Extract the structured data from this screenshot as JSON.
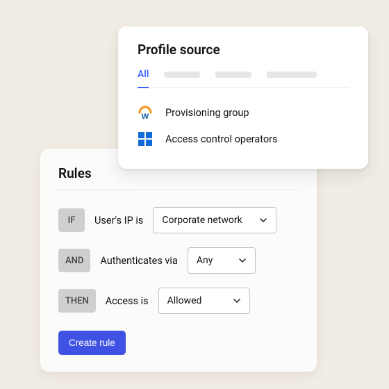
{
  "profile": {
    "title": "Profile source",
    "tabs": {
      "active": "All"
    },
    "sources": [
      {
        "label": "Provisioning group",
        "icon": "workday"
      },
      {
        "label": "Access control operators",
        "icon": "windows"
      }
    ]
  },
  "rules": {
    "title": "Rules",
    "rows": [
      {
        "op": "IF",
        "text": "User's IP is",
        "value": "Corporate network"
      },
      {
        "op": "AND",
        "text": "Authenticates via",
        "value": "Any"
      },
      {
        "op": "THEN",
        "text": "Access is",
        "value": "Allowed"
      }
    ],
    "create_label": "Create rule"
  }
}
